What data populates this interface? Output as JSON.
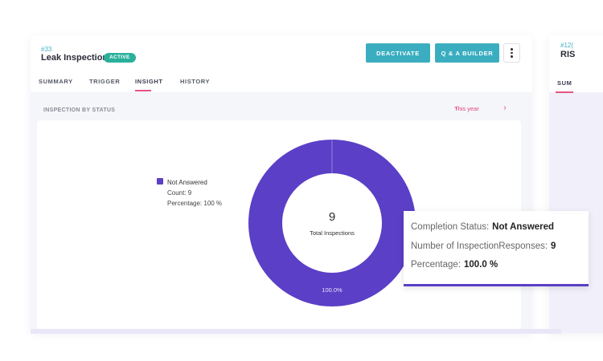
{
  "inspection": {
    "id": "#33",
    "title": "Leak Inspection",
    "status_badge": "ACTIVE"
  },
  "actions": {
    "deactivate_label": "DEACTIVATE",
    "qa_builder_label": "Q & A BUILDER",
    "more_icon": "kebab-vertical-icon"
  },
  "tabs": [
    {
      "label": "SUMMARY",
      "active": false
    },
    {
      "label": "TRIGGER",
      "active": false
    },
    {
      "label": "INSIGHT",
      "active": true
    },
    {
      "label": "HISTORY",
      "active": false
    }
  ],
  "section": {
    "title": "INSPECTION BY STATUS",
    "period": "This year",
    "prev_icon": "chevron-left-icon",
    "next_icon": "chevron-right-icon"
  },
  "legend": {
    "name": "Not Answered",
    "count_text": "Count: 9",
    "percentage_text": "Percentage: 100 %"
  },
  "donut": {
    "center_value": "9",
    "center_label": "Total Inspections",
    "slice_label": "100.0%"
  },
  "tooltip": {
    "status_label": "Completion Status:",
    "status_value": "Not Answered",
    "responses_label": "Number of InspectionResponses:",
    "responses_value": "9",
    "percentage_label": "Percentage:",
    "percentage_value": "100.0 %"
  },
  "side_card": {
    "id": "#12(",
    "title": "RIS",
    "tab": "SUM"
  },
  "chart_data": {
    "type": "pie",
    "categories": [
      "Not Answered"
    ],
    "values": [
      9
    ],
    "percentages": [
      100.0
    ],
    "title": "",
    "legend_position": "left",
    "colors": [
      "#5b3fc6"
    ]
  },
  "colors": {
    "accent_teal": "#3aaec0",
    "badge_green": "#2ab09a",
    "pink": "#e6547f",
    "purple": "#5b3fc6"
  }
}
